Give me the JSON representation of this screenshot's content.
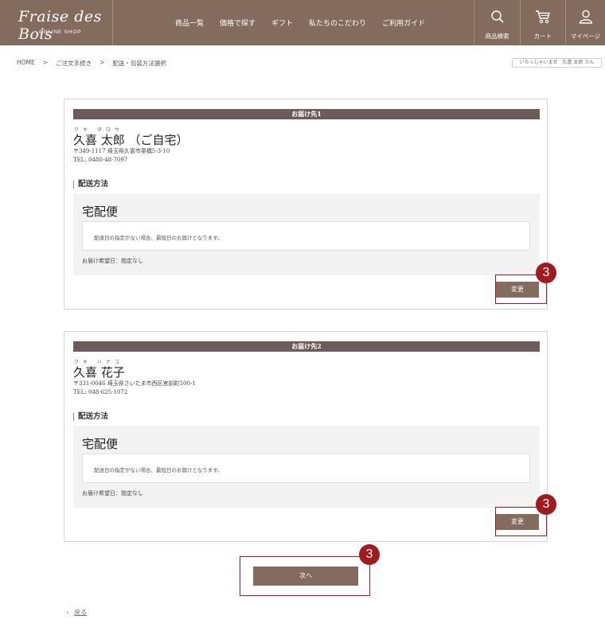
{
  "header": {
    "logo_main": "Fraise des Bois",
    "logo_sub": "ONLINE SHOP",
    "nav": [
      "商品一覧",
      "価格で探す",
      "ギフト",
      "私たちのこだわり",
      "ご利用ガイド"
    ],
    "search_label": "商品検索",
    "cart_label": "カート",
    "mypage_label": "マイページ"
  },
  "breadcrumb": {
    "items": [
      "HOME",
      "ご注文手続き",
      "配送・包装方法選択"
    ],
    "separator": ">"
  },
  "greeting": "いらっしゃいませ　久喜 太郎 さん",
  "deliveries": [
    {
      "heading": "お届け先1",
      "ruby": "クキ タロウ",
      "name": "久喜 太郎 （ご自宅）",
      "address": "〒349-1117 埼玉県久喜市栗橋5-3-10",
      "tel": "TEL: 0480-48-7097",
      "section_title": "配送方法",
      "shipping_method": "宅配便",
      "note": "配達日の指定がない場合、最短日のお届けとなります。",
      "desired_date": "お届け希望日：指定なし",
      "change_label": "変更"
    },
    {
      "heading": "お届け先2",
      "ruby": "クキ ハナコ",
      "name": "久喜 花子",
      "address": "〒331-0046 埼玉県さいたま市西区宮前町500-1",
      "tel": "TEL: 048-625-1072",
      "section_title": "配送方法",
      "shipping_method": "宅配便",
      "note": "配送日の指定がない場合、最短日のお届けとなります。",
      "desired_date": "お届け希望日：指定なし",
      "change_label": "変更"
    }
  ],
  "annotation_number": "3",
  "next_label": "次へ",
  "back_arrow": "‹",
  "back_label": "戻る",
  "colors": {
    "brand": "#836b5d",
    "annotation": "#a31a1e",
    "panel_head": "#6d5b59"
  }
}
